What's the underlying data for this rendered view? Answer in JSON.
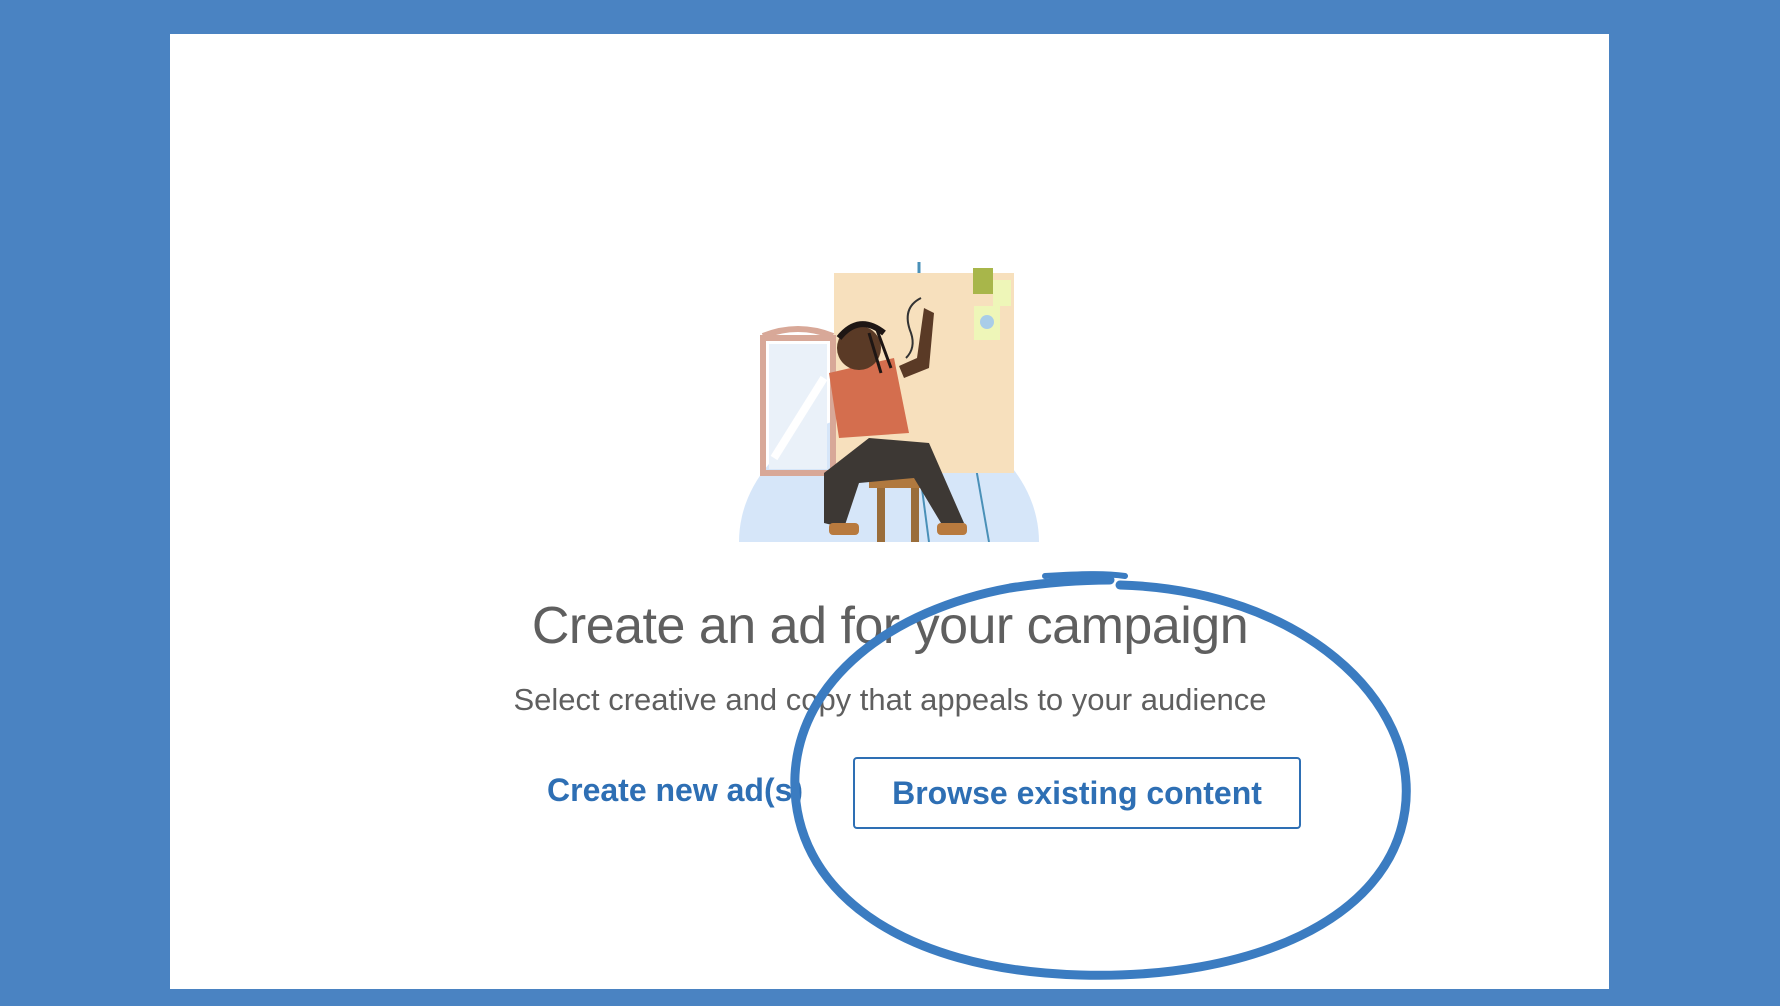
{
  "page": {
    "title": "Create an ad for your campaign",
    "subtitle": "Select creative and copy that appeals to your audience"
  },
  "actions": {
    "create_new_label": "Create new ad(s)",
    "browse_existing_label": "Browse existing content"
  },
  "colors": {
    "frame": "#4a83c2",
    "card": "#ffffff",
    "accent": "#2e6fb4",
    "text": "#5f5f5f",
    "annotation": "#3b7cc1"
  },
  "icons": {
    "illustration": "artist-painting-illustration",
    "annotation": "hand-drawn-circle"
  }
}
